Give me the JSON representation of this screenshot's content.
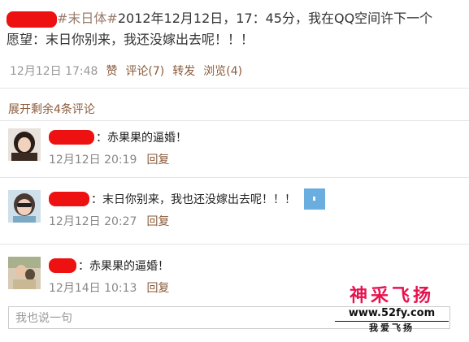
{
  "post": {
    "hashtag": "#末日体#",
    "line1": "2012年12月12日，17：45分，我在QQ空间许下一个",
    "line2": "愿望：末日你别来，我还没嫁出去呢！！！"
  },
  "meta": {
    "time": "12月12日 17:48",
    "like": "赞",
    "comment": "评论(7)",
    "forward": "转发",
    "views": "浏览(4)"
  },
  "expand_label": "展开剩余4条评论",
  "comments": [
    {
      "text": "：赤果果的逼婚！",
      "time": "12月12日 20:19",
      "reply": "回复"
    },
    {
      "text": "：末日你别来，我也还没嫁出去呢！！！",
      "time": "12月12日 20:27",
      "reply": "回复"
    },
    {
      "text": "：赤果果的逼婚！",
      "time": "12月14日 10:13",
      "reply": "回复"
    }
  ],
  "reply_box": {
    "placeholder": "我也说一句"
  },
  "watermark": {
    "title": "神采飞扬",
    "url": "www.52fy.com",
    "sub": "我爱飞扬"
  },
  "colors": {
    "link": "#8a5a3a",
    "redaction": "#ee1111",
    "watermark": "#e8124f"
  }
}
